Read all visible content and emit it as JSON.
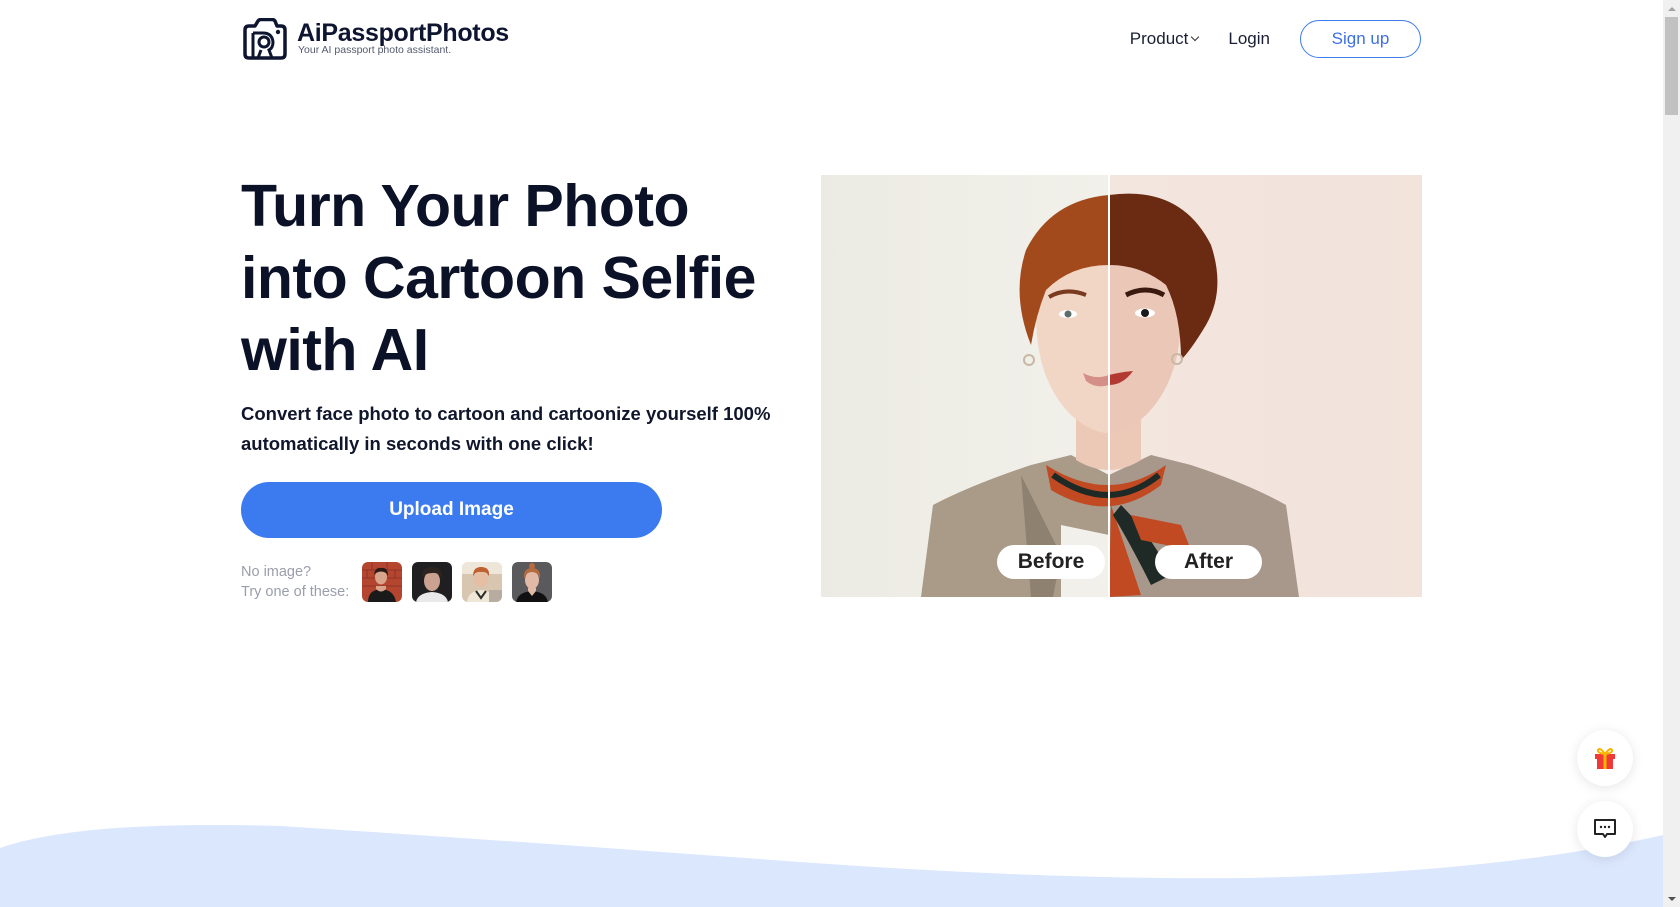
{
  "header": {
    "brand_name": "AiPassportPhotos",
    "tagline": "Your AI passport photo assistant.",
    "logo_icon": "camera-icon",
    "nav": {
      "product_label": "Product",
      "product_icon": "chevron-down-icon",
      "login_label": "Login",
      "signup_label": "Sign up"
    }
  },
  "hero": {
    "title_lines": [
      "Turn Your Photo",
      "into Cartoon Selfie",
      "with AI"
    ],
    "subtitle": "Convert face photo to cartoon and cartoonize yourself 100% automatically in seconds with one click!",
    "upload_label": "Upload Image",
    "samples": {
      "label_line1": "No image?",
      "label_line2": "Try one of these:",
      "items": [
        {
          "name": "sample-woman-red-brick"
        },
        {
          "name": "sample-man-dark"
        },
        {
          "name": "sample-boy-redhair"
        },
        {
          "name": "sample-woman-grey"
        }
      ]
    }
  },
  "compare": {
    "before_label": "Before",
    "after_label": "After"
  },
  "floating": {
    "gift_icon": "gift-icon",
    "chat_icon": "chat-icon"
  },
  "colors": {
    "accent": "#3b7bef",
    "heading": "#0b1126",
    "wave": "#dbe7fd",
    "gift_red": "#f03a3a",
    "gift_ribbon": "#f7b500"
  }
}
